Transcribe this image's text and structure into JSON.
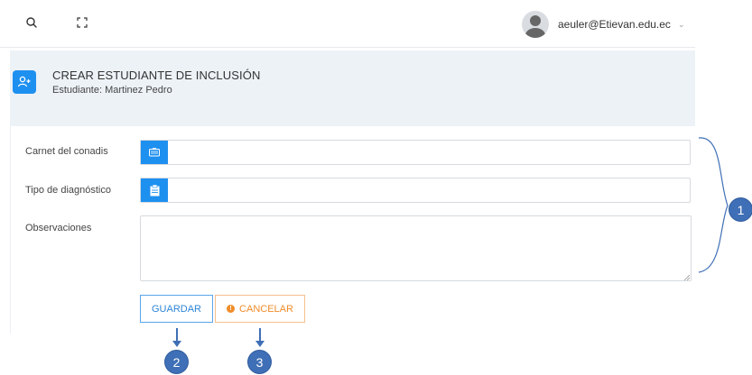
{
  "topbar": {
    "search_icon": "search-icon",
    "fullscreen_icon": "fullscreen-icon",
    "user_email": "aeuler@Etievan.edu.ec",
    "user_chevron": "⌄"
  },
  "header": {
    "title": "CREAR ESTUDIANTE DE INCLUSIÓN",
    "subtitle": "Estudiante: Martinez Pedro",
    "icon": "add-user-icon"
  },
  "form": {
    "fields": [
      {
        "label": "Carnet del conadis",
        "icon": "id-card-icon",
        "value": "",
        "placeholder": ""
      },
      {
        "label": "Tipo de diagnóstico",
        "icon": "clipboard-icon",
        "value": "",
        "placeholder": ""
      },
      {
        "label": "Observaciones",
        "value": "",
        "placeholder": ""
      }
    ],
    "save_label": "GUARDAR",
    "cancel_label": "CANCELAR",
    "cancel_icon": "!"
  },
  "callouts": [
    "1",
    "2",
    "3"
  ],
  "colors": {
    "primary": "#1e90f0",
    "header_bg": "#edf2f7",
    "save_border": "#5aa6ea",
    "cancel": "#f08c2a",
    "callout": "#3f6fb6"
  }
}
